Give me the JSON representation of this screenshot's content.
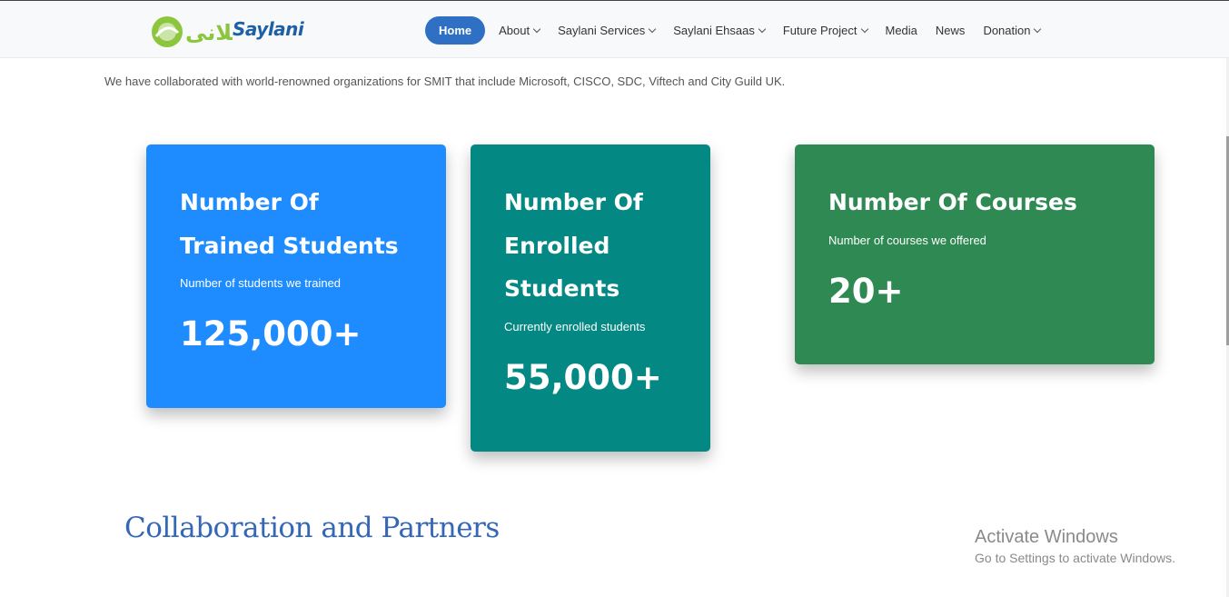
{
  "header": {
    "logo": {
      "text": "Saylani",
      "urdu": "سیلانی"
    },
    "nav": [
      {
        "label": "Home",
        "active": true,
        "dropdown": false
      },
      {
        "label": "About",
        "active": false,
        "dropdown": true
      },
      {
        "label": "Saylani Services",
        "active": false,
        "dropdown": true
      },
      {
        "label": "Saylani Ehsaas",
        "active": false,
        "dropdown": true
      },
      {
        "label": "Future Project",
        "active": false,
        "dropdown": true
      },
      {
        "label": "Media",
        "active": false,
        "dropdown": false
      },
      {
        "label": "News",
        "active": false,
        "dropdown": false
      },
      {
        "label": "Donation",
        "active": false,
        "dropdown": true
      }
    ]
  },
  "intro": "We have collaborated with world-renowned organizations for SMIT that include Microsoft, CISCO, SDC, Viftech and City Guild UK.",
  "stats": [
    {
      "title": "Number Of Trained Students",
      "subtitle": "Number of students we trained",
      "value": "125,000+",
      "color": "#1e8cff"
    },
    {
      "title": "Number Of Enrolled Students",
      "subtitle": "Currently enrolled students",
      "value": "55,000+",
      "color": "#038883"
    },
    {
      "title": "Number Of Courses",
      "subtitle": "Number of courses we offered",
      "value": "20+",
      "color": "#2e8953"
    }
  ],
  "section": {
    "title": "Collaboration and Partners"
  },
  "watermark": {
    "title": "Activate Windows",
    "subtitle": "Go to Settings to activate Windows."
  },
  "colors": {
    "brand_blue": "#2f6fc4",
    "heading_blue": "#3467b6",
    "logo_green": "#8cc63f"
  }
}
